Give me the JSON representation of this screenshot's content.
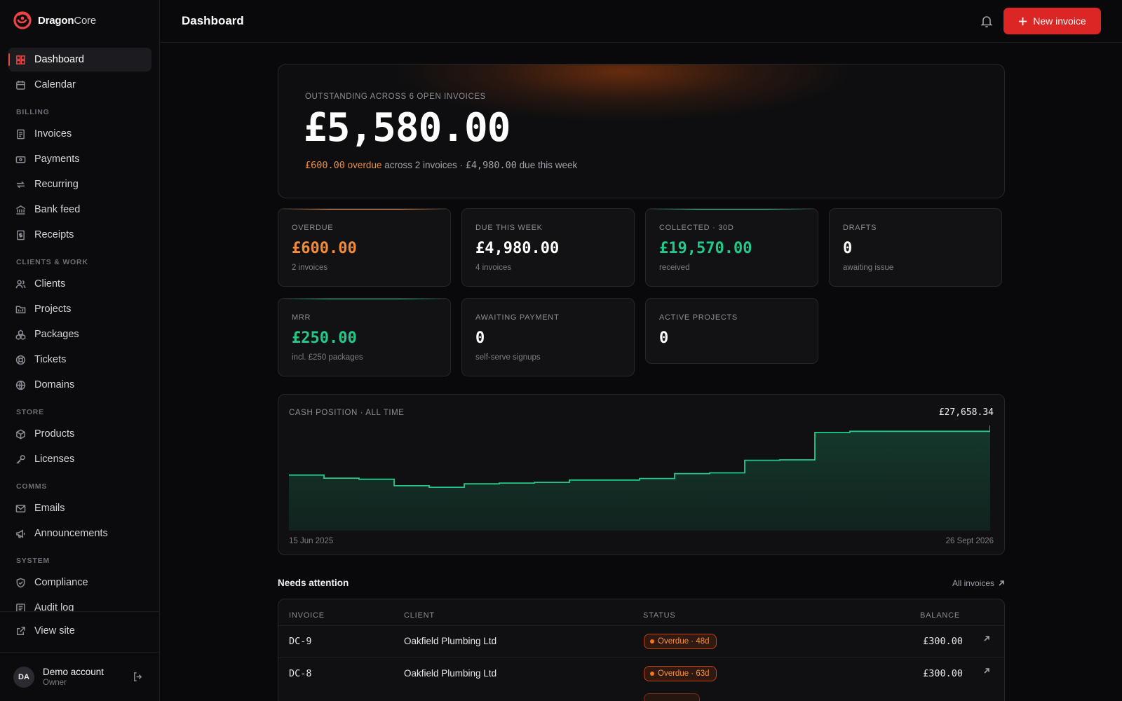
{
  "brand": {
    "name_bold": "Dragon",
    "name_light": "Core"
  },
  "nav": {
    "top": [
      {
        "label": "Dashboard",
        "icon": "grid-icon",
        "active": true
      },
      {
        "label": "Calendar",
        "icon": "calendar-icon"
      }
    ],
    "sections": [
      {
        "title": "BILLING",
        "items": [
          {
            "label": "Invoices",
            "icon": "invoice-icon"
          },
          {
            "label": "Payments",
            "icon": "payment-icon"
          },
          {
            "label": "Recurring",
            "icon": "recurring-icon"
          },
          {
            "label": "Bank feed",
            "icon": "bank-icon"
          },
          {
            "label": "Receipts",
            "icon": "receipt-icon"
          }
        ]
      },
      {
        "title": "CLIENTS & WORK",
        "items": [
          {
            "label": "Clients",
            "icon": "users-icon"
          },
          {
            "label": "Projects",
            "icon": "folder-icon"
          },
          {
            "label": "Packages",
            "icon": "packages-icon"
          },
          {
            "label": "Tickets",
            "icon": "lifebuoy-icon"
          },
          {
            "label": "Domains",
            "icon": "globe-icon"
          }
        ]
      },
      {
        "title": "STORE",
        "items": [
          {
            "label": "Products",
            "icon": "box-icon"
          },
          {
            "label": "Licenses",
            "icon": "key-icon"
          }
        ]
      },
      {
        "title": "COMMS",
        "items": [
          {
            "label": "Emails",
            "icon": "mail-icon"
          },
          {
            "label": "Announcements",
            "icon": "megaphone-icon"
          }
        ]
      },
      {
        "title": "SYSTEM",
        "items": [
          {
            "label": "Compliance",
            "icon": "shield-icon"
          },
          {
            "label": "Audit log",
            "icon": "list-icon"
          }
        ]
      }
    ],
    "view_site": "View site"
  },
  "account": {
    "initials": "DA",
    "name": "Demo account",
    "role": "Owner"
  },
  "header": {
    "title": "Dashboard",
    "new_invoice": "New invoice"
  },
  "hero": {
    "label": "OUTSTANDING ACROSS 6 OPEN INVOICES",
    "amount": "£5,580.00",
    "overdue_amount": "£600.00",
    "overdue_word": "overdue",
    "across_text": " across 2 invoices · ",
    "due_amount": "£4,980.00",
    "due_text": " due this week"
  },
  "stats": [
    {
      "label": "OVERDUE",
      "value": "£600.00",
      "note": "2 invoices",
      "accent": "#f08c3a"
    },
    {
      "label": "DUE THIS WEEK",
      "value": "£4,980.00",
      "note": "4 invoices",
      "accent": ""
    },
    {
      "label": "COLLECTED · 30D",
      "value": "£19,570.00",
      "note": "received",
      "accent": "#22c98a"
    },
    {
      "label": "DRAFTS",
      "value": "0",
      "note": "awaiting issue",
      "accent": ""
    },
    {
      "label": "MRR",
      "value": "£250.00",
      "note": "incl. £250 packages",
      "accent": "#22c98a"
    },
    {
      "label": "AWAITING PAYMENT",
      "value": "0",
      "note": "self-serve signups",
      "accent": ""
    },
    {
      "label": "ACTIVE PROJECTS",
      "value": "0",
      "note": "",
      "accent": ""
    }
  ],
  "chart_data": {
    "type": "area",
    "title": "CASH POSITION · ALL TIME",
    "total": "£27,658.34",
    "x_start_label": "15 Jun 2025",
    "x_end_label": "26 Sept 2026",
    "step": true,
    "color": "#22c98a",
    "ylim": [
      0,
      28000
    ],
    "values": [
      14600,
      13800,
      13500,
      11800,
      11400,
      12300,
      12500,
      12700,
      13300,
      13300,
      13700,
      15000,
      15200,
      18500,
      18600,
      25800,
      26100,
      26100,
      26100,
      26100,
      27658.34
    ]
  },
  "attention": {
    "title": "Needs attention",
    "link": "All invoices",
    "columns": [
      "INVOICE",
      "CLIENT",
      "STATUS",
      "BALANCE"
    ],
    "rows": [
      {
        "invoice": "DC-9",
        "client": "Oakfield Plumbing Ltd",
        "status": "Overdue · 48d",
        "balance": "£300.00"
      },
      {
        "invoice": "DC-8",
        "client": "Oakfield Plumbing Ltd",
        "status": "Overdue · 63d",
        "balance": "£300.00"
      }
    ]
  }
}
